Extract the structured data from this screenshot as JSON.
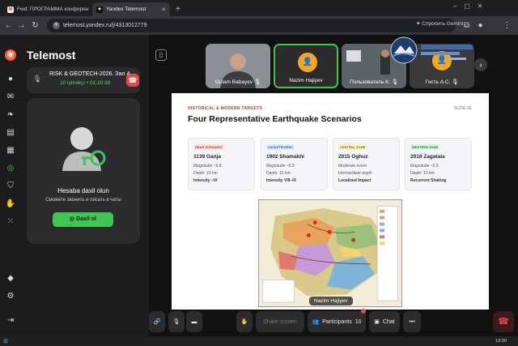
{
  "browser": {
    "tabs": [
      {
        "label": "Fwd: ПРОГРАММА конферен",
        "icon": "gmail-icon"
      },
      {
        "label": "Yandex Telemost",
        "icon": "telemost-icon",
        "active": true
      }
    ],
    "new_tab": "+",
    "url": "telemost.yandex.ru/j/4313012779",
    "gemini_label": "Спросить Gemini"
  },
  "sidebar": {
    "brand": "Telemost",
    "meeting": {
      "title": "RISK & GEOTECH-2026. Зал А",
      "time": "10 iştirakçı • 01:20:38"
    },
    "login": {
      "title": "Hesaba daxil olun",
      "subtitle": "Сможете звонить и писать в чаты",
      "button": "Daxil ol"
    }
  },
  "participants_strip": [
    {
      "name": "Gulam Babayev",
      "muted": true
    },
    {
      "name": "Nazim Hajiyev",
      "active": true
    },
    {
      "name": "Пользователь К.",
      "muted": true
    },
    {
      "name": "Гость А.С.",
      "muted": true
    }
  ],
  "slide": {
    "kicker": "HISTORICAL & MODERN TARGETS",
    "number": "SLIDE 06",
    "title": "Four Representative Earthquake Scenarios",
    "cards": [
      {
        "tag": "NEAR SCENARIO",
        "name": "1139 Ganja",
        "lines": [
          "Magnitude ~6.8",
          "Depth: 15 km"
        ],
        "bold": "Intensity ~IX",
        "tag_color": "#c0392b",
        "tag_bg": "#fde2e0"
      },
      {
        "tag": "CATASTROPHIC",
        "name": "1902 Shamakhi",
        "lines": [
          "Magnitude ~6.9",
          "Depth: 15 km"
        ],
        "bold": "Intensity VIII–IX",
        "tag_color": "#2a5db0",
        "tag_bg": "#dfe9fb"
      },
      {
        "tag": "CENTRAL ZONE",
        "name": "2015 Oghuz",
        "lines": [
          "Moderate event",
          "Intermediate depth"
        ],
        "bold": "Localized Impact",
        "tag_color": "#8a6d00",
        "tag_bg": "#fbf0c7"
      },
      {
        "tag": "WESTERN ZONE",
        "name": "2018 Zagatala",
        "lines": [
          "Magnitude ~5.5",
          "Depth: 10 km"
        ],
        "bold": "Recurrent Shaking",
        "tag_color": "#1f7a3a",
        "tag_bg": "#d9f3e1"
      }
    ]
  },
  "speaker_tooltip": "Nazim Hajiyev",
  "controls": {
    "share": "Share screen",
    "participants": "Participants",
    "participants_count": "10",
    "chat": "Chat",
    "more": "•••"
  },
  "taskbar": {
    "clock": "13:30"
  },
  "colors": {
    "accent_green": "#3ec653",
    "danger": "#e5484d",
    "orange_avatar": "#f5a623"
  }
}
